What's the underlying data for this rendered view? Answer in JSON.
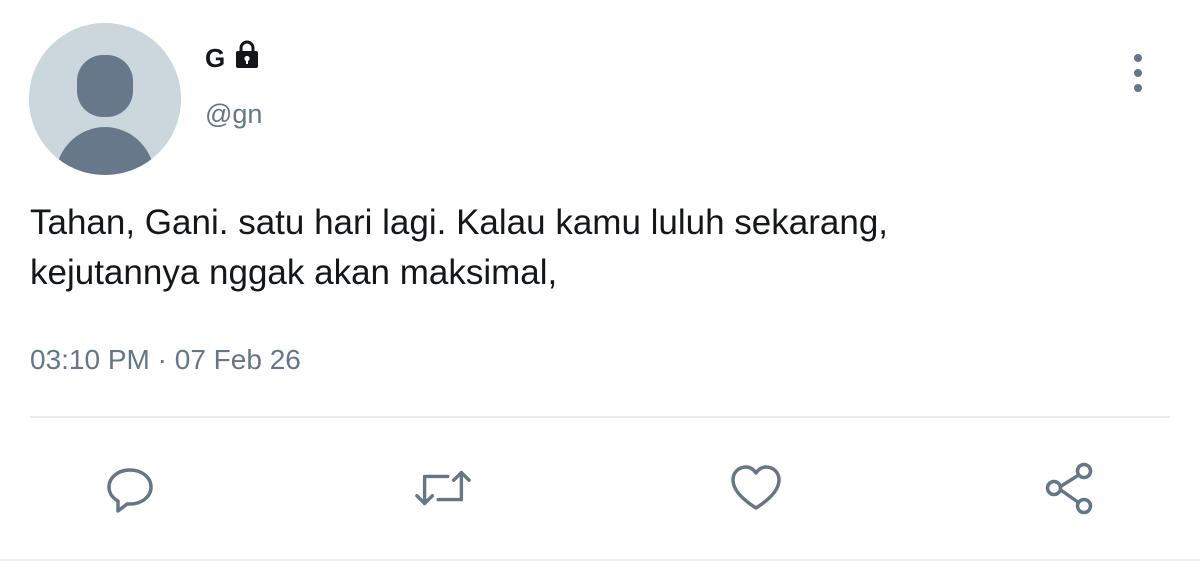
{
  "user": {
    "display_name": "G",
    "handle": "@gn",
    "avatar_icon": "default-avatar-icon",
    "protected_icon": "lock-icon"
  },
  "tweet": {
    "text_lines": [
      "Tahan, Gani. satu hari lagi. Kalau kamu luluh sekarang,",
      "kejutannya nggak akan maksimal,"
    ],
    "time": "03:10 PM",
    "separator": "·",
    "date": "07 Feb 26"
  },
  "actions": [
    {
      "icon": "reply-icon"
    },
    {
      "icon": "retweet-icon"
    },
    {
      "icon": "like-icon"
    },
    {
      "icon": "share-icon"
    }
  ],
  "menu": {
    "icon": "more-vertical-icon"
  },
  "colors": {
    "text": "#14171a",
    "secondary": "#657786",
    "avatar_bg": "#ccd6dd",
    "avatar_figure": "#66788a",
    "divider": "#e6ecf0"
  }
}
